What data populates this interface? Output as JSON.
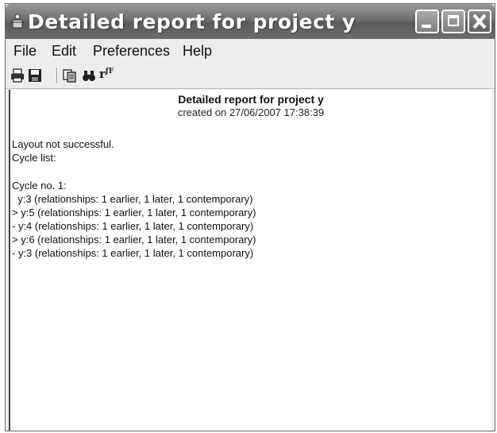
{
  "window": {
    "title": "Detailed report for project y"
  },
  "menu": [
    "File",
    "Edit",
    "Preferences",
    "Help"
  ],
  "toolbar": {
    "icons": [
      "printer-icon",
      "save-icon",
      "copy-icon",
      "find-icon",
      "font-icon"
    ],
    "font_glyph": "r",
    "font_glyph_sup": "ƒF"
  },
  "report": {
    "title": "Detailed report for project y",
    "created": "created on 27/06/2007 17:38:39",
    "lines": [
      "Layout not successful.",
      "Cycle list:",
      "Cycle no. 1:",
      "  y:3 (relationships: 1 earlier, 1 later, 1 contemporary)",
      "> y:5 (relationships: 1 earlier, 1 later, 1 contemporary)",
      "- y:4 (relationships: 1 earlier, 1 later, 1 contemporary)",
      "> y:6 (relationships: 1 earlier, 1 later, 1 contemporary)",
      "- y:3 (relationships: 1 earlier, 1 later, 1 contemporary)"
    ]
  }
}
